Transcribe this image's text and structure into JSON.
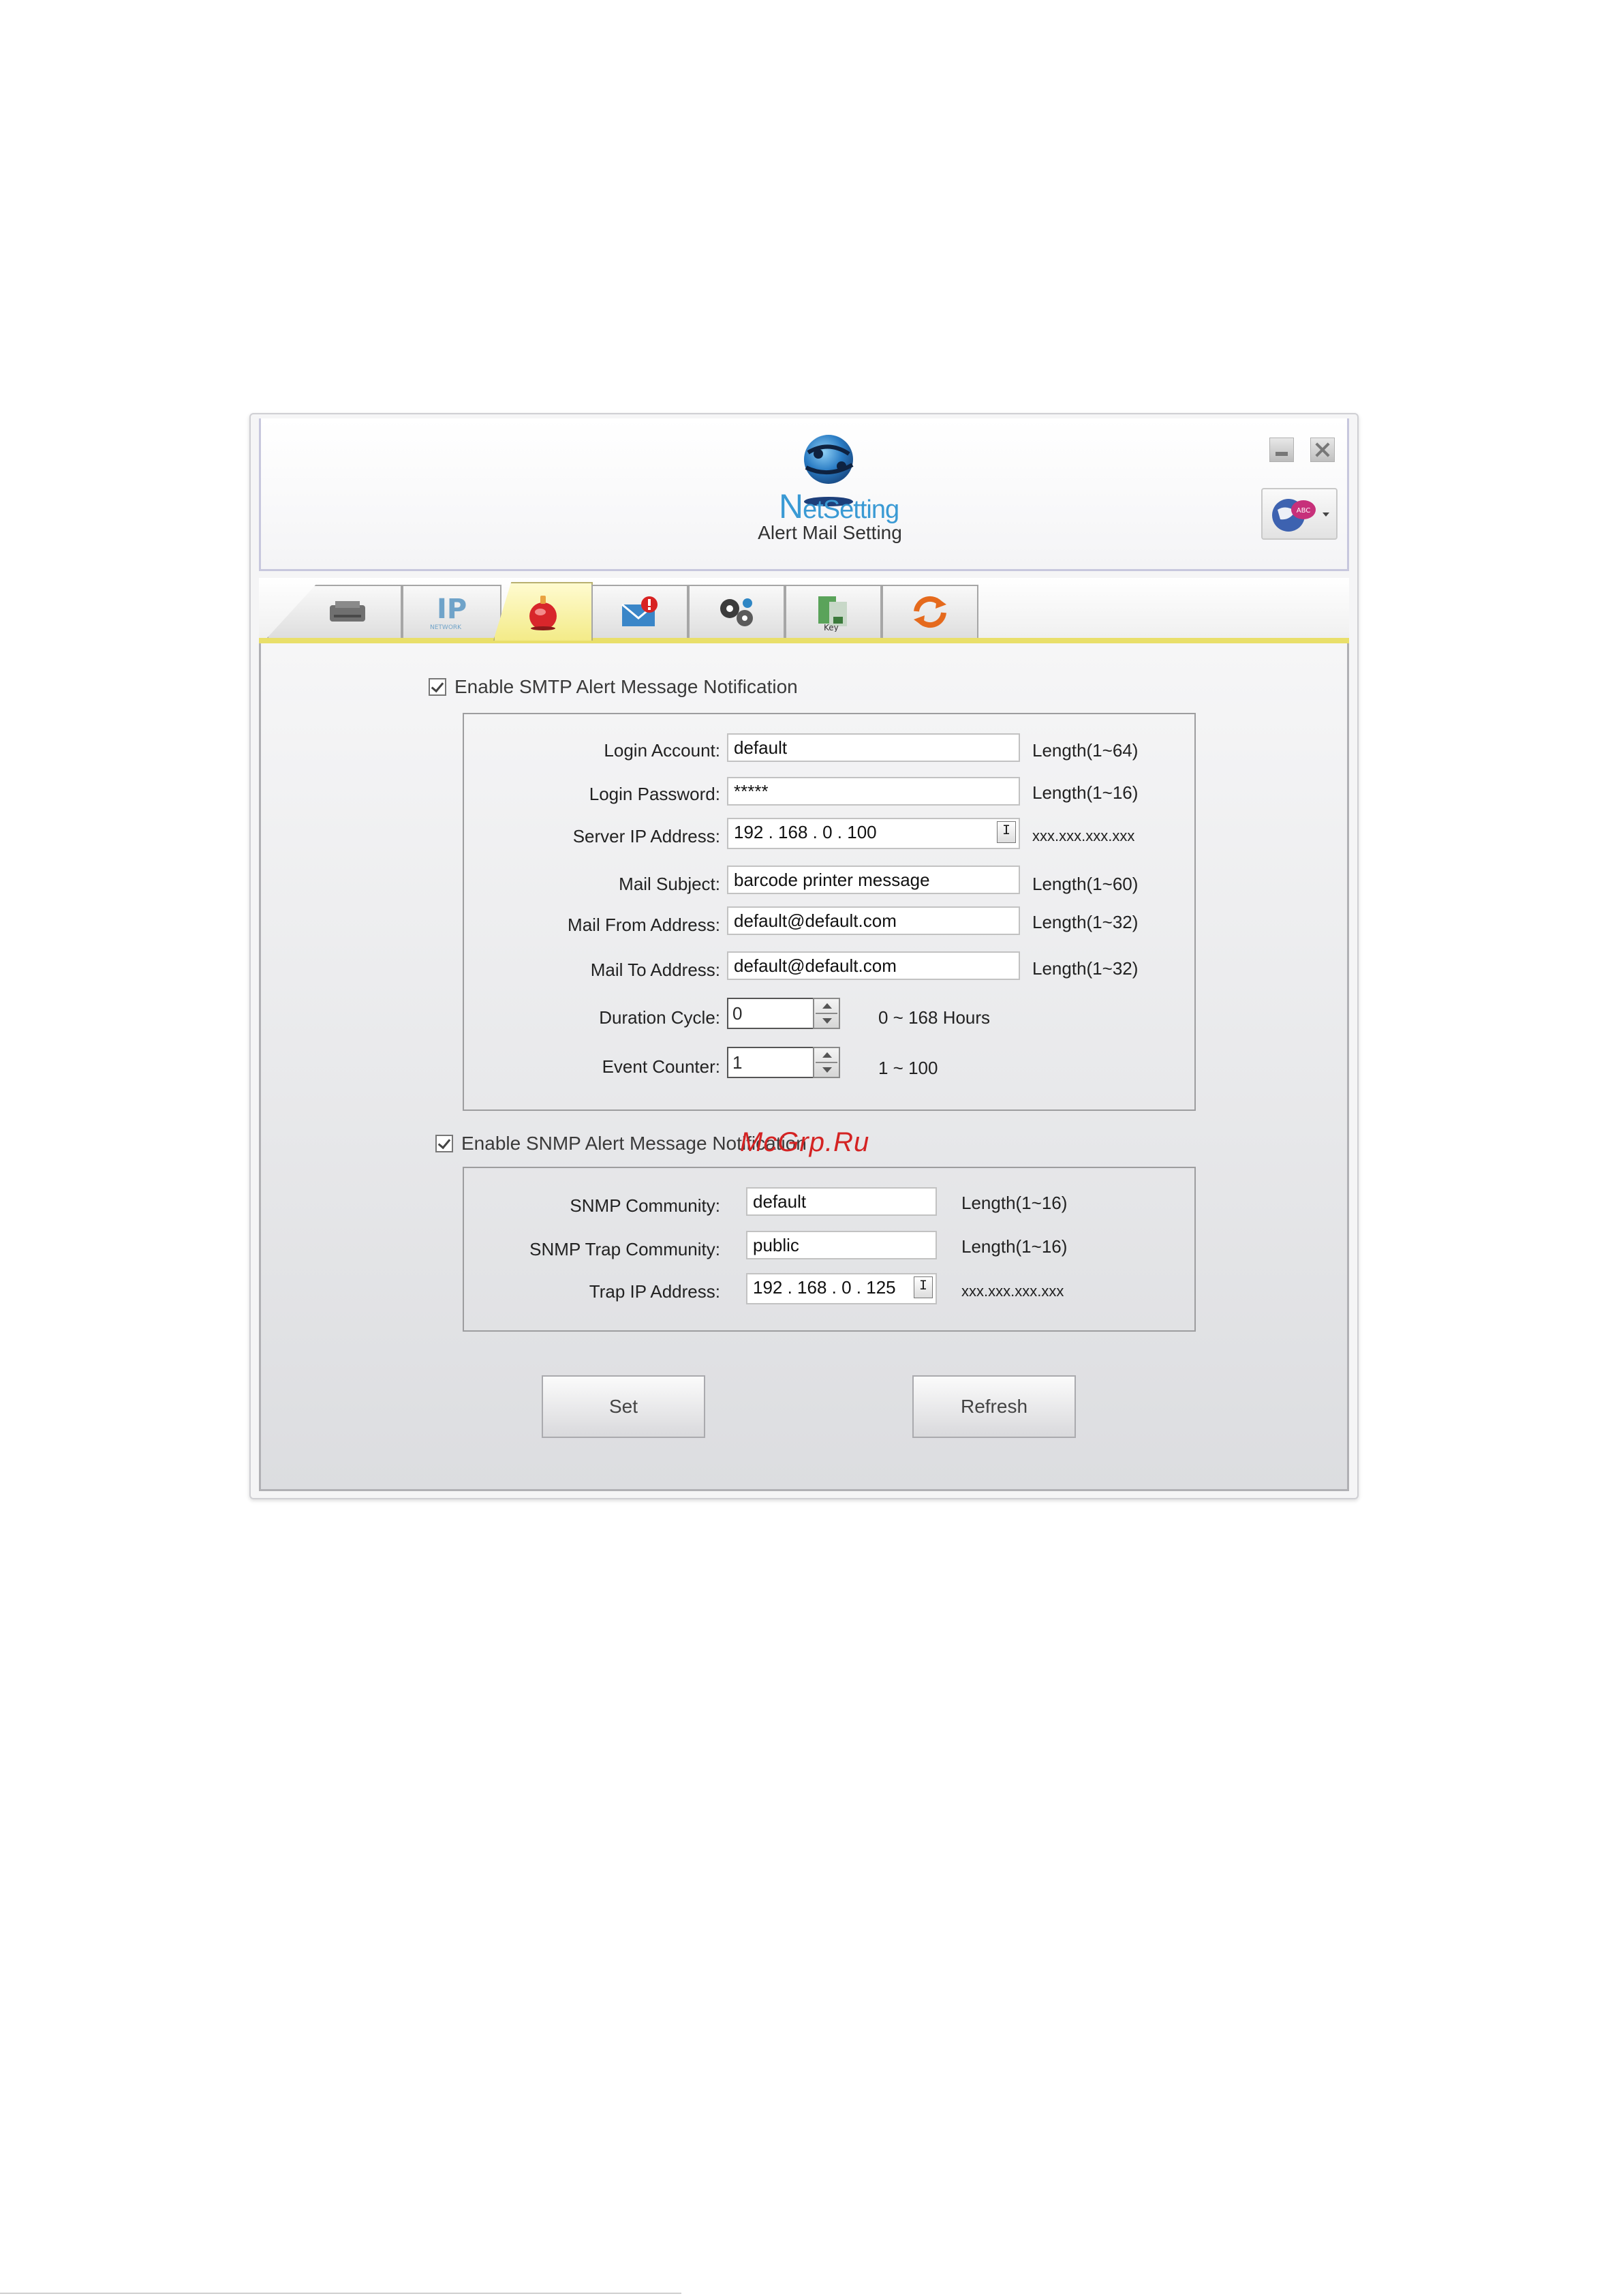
{
  "header": {
    "logo_text_initial": "N",
    "logo_text_rest": "etSetting",
    "page_title": "Alert Mail Setting"
  },
  "tabs": [
    {
      "icon": "printer-icon"
    },
    {
      "icon": "ip-network-icon"
    },
    {
      "icon": "alert-bell-icon",
      "active": true
    },
    {
      "icon": "mail-alert-icon"
    },
    {
      "icon": "gears-icon"
    },
    {
      "icon": "key-config-icon"
    },
    {
      "icon": "refresh-arrows-icon"
    }
  ],
  "smtp": {
    "enable_label": "Enable SMTP Alert Message Notification",
    "login_account": {
      "label": "Login Account:",
      "value": "default",
      "hint": "Length(1~64)"
    },
    "login_password": {
      "label": "Login Password:",
      "value": "*****",
      "hint": "Length(1~16)"
    },
    "server_ip": {
      "label": "Server IP Address:",
      "value": "192 . 168 . 0 . 100",
      "hint": "xxx.xxx.xxx.xxx"
    },
    "mail_subject": {
      "label": "Mail Subject:",
      "value": "barcode printer message",
      "hint": "Length(1~60)"
    },
    "mail_from": {
      "label": "Mail From Address:",
      "value": "default@default.com",
      "hint": "Length(1~32)"
    },
    "mail_to": {
      "label": "Mail To Address:",
      "value": "default@default.com",
      "hint": "Length(1~32)"
    },
    "duration_cycle": {
      "label": "Duration Cycle:",
      "value": "0",
      "hint": "0 ~ 168 Hours"
    },
    "event_counter": {
      "label": "Event Counter:",
      "value": "1",
      "hint": "1 ~ 100"
    }
  },
  "snmp": {
    "enable_label": "Enable SNMP Alert Message Notification",
    "community": {
      "label": "SNMP Community:",
      "value": "default",
      "hint": "Length(1~16)"
    },
    "trap_community": {
      "label": "SNMP Trap Community:",
      "value": "public",
      "hint": "Length(1~16)"
    },
    "trap_ip": {
      "label": "Trap IP Address:",
      "value": "192 . 168 . 0 . 125",
      "hint": "xxx.xxx.xxx.xxx"
    }
  },
  "ip_button_glyph": "I",
  "buttons": {
    "set": "Set",
    "refresh": "Refresh"
  },
  "watermark": "McGrp.Ru"
}
